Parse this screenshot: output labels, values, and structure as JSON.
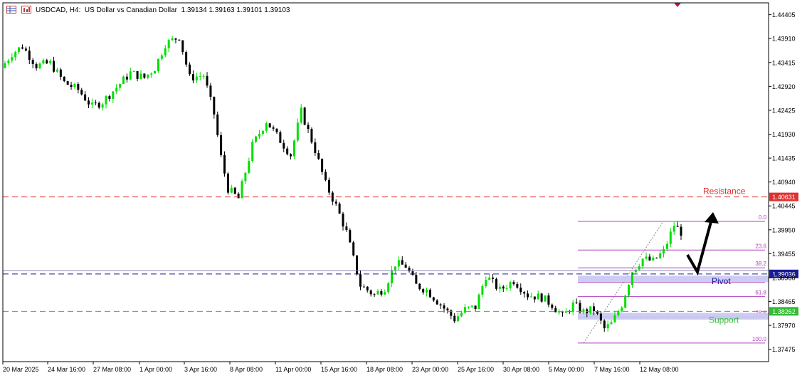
{
  "header": {
    "symbol_line": "USDCAD, H4:  US Dollar vs Canadian Dollar  1.39134 1.39163 1.39101 1.39103",
    "icon1": "grid-icon",
    "icon2": "bars-chart-icon"
  },
  "colors": {
    "bull": "#00e000",
    "bear": "#000000",
    "resistance": "#e03030",
    "pivot": "#1a1a99",
    "support": "#33bb33",
    "fib": "#b040c0",
    "zone": "#c8c8f2",
    "price_tag": "#2233cc"
  },
  "chart_data": {
    "type": "candlestick",
    "title": "USDCAD, H4",
    "ylim": [
      1.3722,
      1.4465
    ],
    "y_ticks": [
      "1.44405",
      "1.43910",
      "1.43415",
      "1.42920",
      "1.42425",
      "1.41930",
      "1.41435",
      "1.40940",
      "1.40445",
      "1.39950",
      "1.39455",
      "1.38960",
      "1.38465",
      "1.37970",
      "1.37475"
    ],
    "x_ticks": [
      "20 Mar 2025",
      "24 Mar 16:00",
      "27 Mar 08:00",
      "1 Apr 00:00",
      "3 Apr 16:00",
      "8 Apr 08:00",
      "11 Apr 00:00",
      "15 Apr 16:00",
      "18 Apr 08:00",
      "23 Apr 00:00",
      "25 Apr 16:00",
      "30 Apr 08:00",
      "5 May 00:00",
      "7 May 16:00",
      "12 May 08:00"
    ],
    "candles": 195,
    "close_path": [
      [
        0,
        1.433
      ],
      [
        3,
        1.436
      ],
      [
        6,
        1.4375
      ],
      [
        10,
        1.4335
      ],
      [
        14,
        1.434
      ],
      [
        18,
        1.43
      ],
      [
        22,
        1.4285
      ],
      [
        26,
        1.425
      ],
      [
        29,
        1.426
      ],
      [
        33,
        1.429
      ],
      [
        37,
        1.432
      ],
      [
        41,
        1.431
      ],
      [
        44,
        1.433
      ],
      [
        47,
        1.438
      ],
      [
        51,
        1.4395
      ],
      [
        54,
        1.431
      ],
      [
        58,
        1.4315
      ],
      [
        61,
        1.4235
      ],
      [
        63,
        1.4145
      ],
      [
        65,
        1.408
      ],
      [
        68,
        1.406
      ],
      [
        72,
        1.417
      ],
      [
        76,
        1.422
      ],
      [
        80,
        1.418
      ],
      [
        83,
        1.415
      ],
      [
        86,
        1.424
      ],
      [
        90,
        1.416
      ],
      [
        93,
        1.409
      ],
      [
        96,
        1.4045
      ],
      [
        99,
        1.399
      ],
      [
        103,
        1.388
      ],
      [
        107,
        1.386
      ],
      [
        110,
        1.3875
      ],
      [
        113,
        1.3925
      ],
      [
        116,
        1.392
      ],
      [
        119,
        1.388
      ],
      [
        122,
        1.387
      ],
      [
        126,
        1.384
      ],
      [
        130,
        1.381
      ],
      [
        133,
        1.383
      ],
      [
        136,
        1.3835
      ],
      [
        139,
        1.39
      ],
      [
        143,
        1.387
      ],
      [
        147,
        1.389
      ],
      [
        151,
        1.386
      ],
      [
        155,
        1.3855
      ],
      [
        158,
        1.384
      ],
      [
        161,
        1.3815
      ],
      [
        164,
        1.384
      ],
      [
        167,
        1.3825
      ],
      [
        170,
        1.383
      ],
      [
        173,
        1.379
      ],
      [
        175,
        1.38
      ],
      [
        178,
        1.384
      ],
      [
        181,
        1.391
      ],
      [
        184,
        1.3935
      ],
      [
        187,
        1.393
      ],
      [
        190,
        1.395
      ],
      [
        193,
        1.4005
      ],
      [
        197,
        1.3975
      ],
      [
        200,
        1.393
      ],
      [
        202,
        1.391
      ]
    ],
    "levels": [
      {
        "name": "Resistance",
        "value": 1.40631,
        "tag": "1.40631"
      },
      {
        "name": "Pivot",
        "value": 1.39036,
        "tag": "1.39036"
      },
      {
        "name": "Support",
        "value": 1.38262,
        "tag": "1.38262"
      }
    ],
    "current_price": 1.39103,
    "fibonacci": {
      "high": 1.40125,
      "low": 1.37605,
      "levels": [
        {
          "label": "0.0",
          "ratio": 0.0
        },
        {
          "label": "23.6",
          "ratio": 0.236
        },
        {
          "label": "38.2",
          "ratio": 0.382
        },
        {
          "label": "50.0",
          "ratio": 0.5
        },
        {
          "label": "61.8",
          "ratio": 0.618
        },
        {
          "label": "78.6",
          "ratio": 0.786
        },
        {
          "label": "100.0",
          "ratio": 1.0
        }
      ]
    },
    "zones": [
      {
        "name": "Pivot",
        "from": 1.3887,
        "to": 1.39
      },
      {
        "name": "Support",
        "from": 1.3809,
        "to": 1.3823
      }
    ],
    "annotations": [
      "Resistance",
      "Pivot",
      "Support"
    ]
  }
}
